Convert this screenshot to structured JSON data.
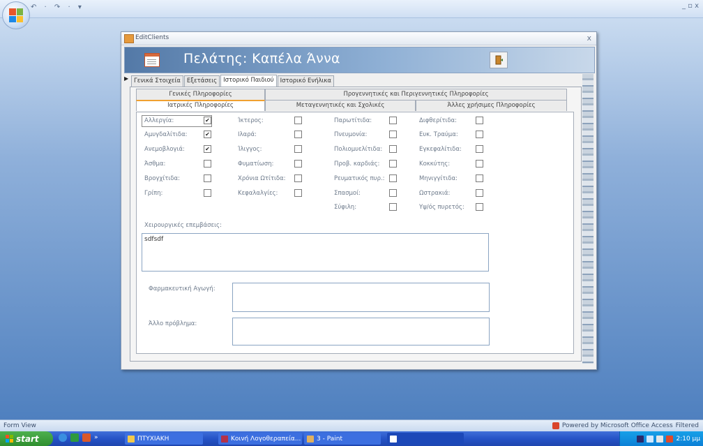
{
  "app": {
    "quick_access": "↶ · ↷ · ▾",
    "window_controls": "_ ▫ x"
  },
  "dialog": {
    "caption": "EditClients",
    "close": "x",
    "header_title": "Πελάτης: Καπέλα Άννα",
    "outer_tabs": [
      "Γενικά Στοιχεία",
      "Εξετάσεις",
      "Ιστορικό Παιδιού",
      "Ιστορικό Ενήλικα"
    ],
    "inner_tabs_row1": [
      "Γενικές Πληροφορίες",
      "Προγεννητικές και Περιγεννητικές Πληροφορίες"
    ],
    "inner_tabs_row2": [
      "Ιατρικές Πληροφορίες",
      "Μεταγεννητικές και Σχολικές",
      "Άλλες χρήσιμες Πληροφορίες"
    ],
    "active_outer_tab": "Ιστορικό Παιδιού",
    "active_inner_tab": "Ιατρικές Πληροφορίες"
  },
  "conditions": {
    "col1": [
      {
        "label": "Αλλεργία:",
        "checked": true
      },
      {
        "label": "Αμυγδαλίτιδα:",
        "checked": true
      },
      {
        "label": "Ανεμοβλογιά:",
        "checked": true
      },
      {
        "label": "Άσθμα:",
        "checked": false
      },
      {
        "label": "Βρογχίτιδα:",
        "checked": false
      },
      {
        "label": "Γρίπη:",
        "checked": false
      }
    ],
    "col2": [
      {
        "label": "Ίκτερος:",
        "checked": false
      },
      {
        "label": "Ιλαρά:",
        "checked": false
      },
      {
        "label": "Ίλιγγος:",
        "checked": false
      },
      {
        "label": "Φυματίωση:",
        "checked": false
      },
      {
        "label": "Χρόνια Ωτίτιδα:",
        "checked": false
      },
      {
        "label": "Κεφαλαλγίες:",
        "checked": false
      }
    ],
    "col3": [
      {
        "label": "Παρωτίτιδα:",
        "checked": false
      },
      {
        "label": "Πνευμονία:",
        "checked": false
      },
      {
        "label": "Πολιομυελίτιδα:",
        "checked": false
      },
      {
        "label": "Προβ. καρδιάς:",
        "checked": false
      },
      {
        "label": "Ρευματικός πυρ.:",
        "checked": false
      },
      {
        "label": "Σπασμοί:",
        "checked": false
      },
      {
        "label": "Σύφιλη:",
        "checked": false
      }
    ],
    "col4": [
      {
        "label": "Διφθερίτιδα:",
        "checked": false
      },
      {
        "label": "Ευκ. Τραύμα:",
        "checked": false
      },
      {
        "label": "Εγκεφαλίτιδα:",
        "checked": false
      },
      {
        "label": "Κοκκύτης:",
        "checked": false
      },
      {
        "label": "Μηνιγγίτιδα:",
        "checked": false
      },
      {
        "label": "Ωστρακιά:",
        "checked": false
      },
      {
        "label": "Υψ/ός πυρετός:",
        "checked": false
      }
    ]
  },
  "fields": {
    "surgery_label": "Χειρουργικές επεμβάσεις:",
    "surgery_value": "sdfsdf",
    "medication_label": "Φαρμακευτική Αγωγή:",
    "medication_value": "",
    "other_label": "Άλλο πρόβλημα:",
    "other_value": ""
  },
  "statusbar": {
    "left": "Form View",
    "right": "Powered by Microsoft Office Access",
    "filter": "Filtered"
  },
  "taskbar": {
    "start": "start",
    "more": "»",
    "buttons": [
      "ΠΤΥΧΙΑΚΗ",
      "Κοινή Λογοθεραπεία...",
      "3 - Paint",
      ""
    ],
    "clock": "2:10 μμ"
  }
}
